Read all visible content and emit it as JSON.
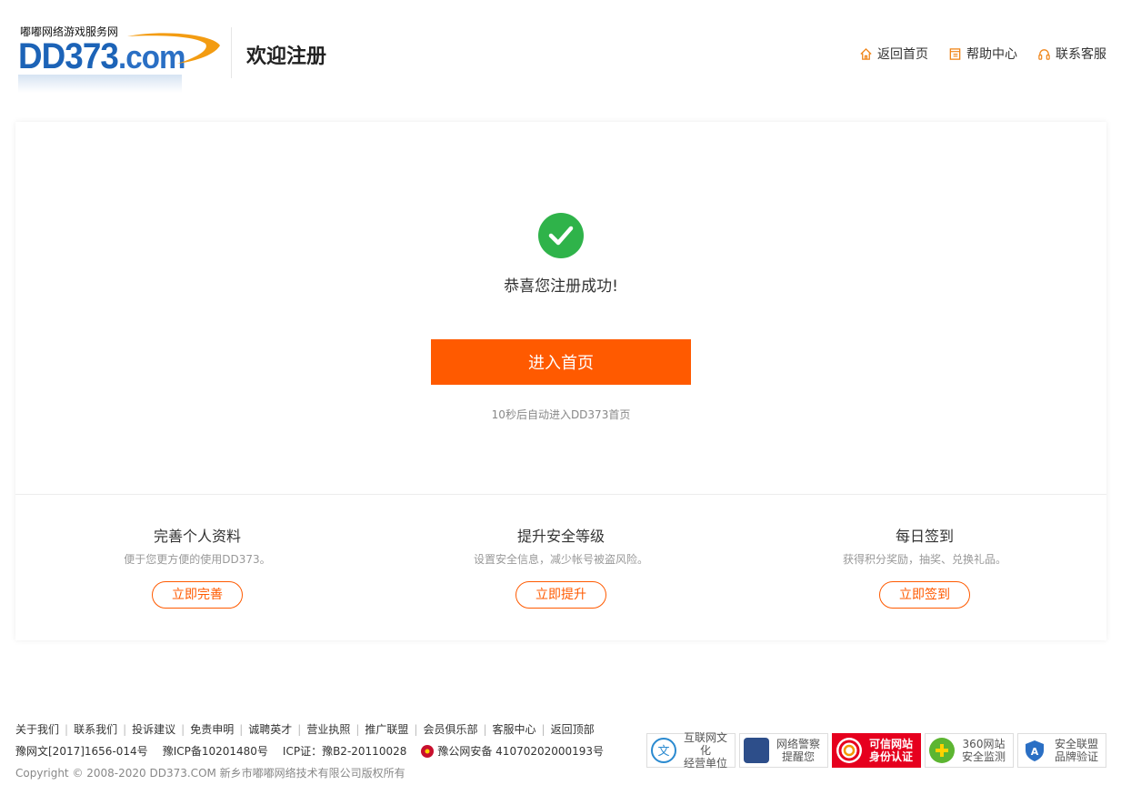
{
  "header": {
    "logo_slogan": "嘟嘟网络游戏服务网",
    "logo_main": "DD373",
    "logo_suffix": ".com",
    "title": "欢迎注册",
    "nav": [
      {
        "label": "返回首页",
        "icon": "home-icon"
      },
      {
        "label": "帮助中心",
        "icon": "book-icon"
      },
      {
        "label": "联系客服",
        "icon": "headset-icon"
      }
    ]
  },
  "main": {
    "success_text": "恭喜您注册成功!",
    "enter_button": "进入首页",
    "countdown": "10秒后自动进入DD373首页",
    "features": [
      {
        "title": "完善个人资料",
        "desc": "便于您更方便的使用DD373。",
        "button": "立即完善"
      },
      {
        "title": "提升安全等级",
        "desc": "设置安全信息，减少帐号被盗风险。",
        "button": "立即提升"
      },
      {
        "title": "每日签到",
        "desc": "获得积分奖励，抽奖、兑换礼品。",
        "button": "立即签到"
      }
    ]
  },
  "footer": {
    "links": [
      "关于我们",
      "联系我们",
      "投诉建议",
      "免责申明",
      "诚聘英才",
      "营业执照",
      "推广联盟",
      "会员俱乐部",
      "客服中心",
      "返回顶部"
    ],
    "license1": "豫网文[2017]1656-014号",
    "license2": "豫ICP备10201480号",
    "license3": "ICP证：豫B2-20110028",
    "license4": "豫公网安备 41070202000193号",
    "copyright": "Copyright © 2008-2020 DD373.COM 新乡市嘟嘟网络技术有限公司版权所有",
    "badges": [
      {
        "text": "互联网文化\n经营单位",
        "icon": "culture-icon"
      },
      {
        "text": "网络警察\n提醒您",
        "icon": "police-icon"
      },
      {
        "text": "可信网站\n身份认证",
        "icon": "trust-icon"
      },
      {
        "text": "360网站\n安全监测",
        "icon": "360-icon"
      },
      {
        "text": "安全联盟\n品牌验证",
        "icon": "shield-icon"
      }
    ]
  },
  "colors": {
    "accent": "#ff5a00",
    "success": "#2fb34a",
    "logo_blue": "#1c63b7"
  }
}
